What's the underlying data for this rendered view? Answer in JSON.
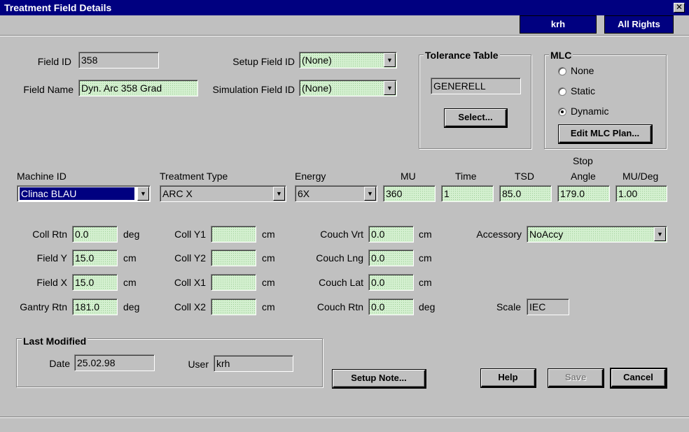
{
  "window": {
    "title": "Treatment Field Details",
    "close_glyph": "✕"
  },
  "header": {
    "user_badge": "krh",
    "rights_badge": "All Rights"
  },
  "field_id": {
    "label": "Field ID",
    "value": "358"
  },
  "field_name": {
    "label": "Field Name",
    "value": "Dyn. Arc 358 Grad"
  },
  "setup_field_id": {
    "label": "Setup Field ID",
    "value": "(None)"
  },
  "simulation_field_id": {
    "label": "Simulation Field ID",
    "value": "(None)"
  },
  "tolerance_table": {
    "title": "Tolerance Table",
    "value": "GENERELL",
    "select_button": "Select..."
  },
  "mlc": {
    "title": "MLC",
    "options": [
      "None",
      "Static",
      "Dynamic"
    ],
    "selected": "Dynamic",
    "edit_button": "Edit MLC Plan..."
  },
  "machine": {
    "machine_id_label": "Machine ID",
    "machine_id": "Clinac BLAU",
    "treatment_type_label": "Treatment Type",
    "treatment_type": "ARC X",
    "energy_label": "Energy",
    "energy": "6X",
    "mu_label": "MU",
    "mu": "360",
    "time_label": "Time",
    "time": "1",
    "tsd_label": "TSD",
    "tsd": "85.0",
    "stop_angle_label_1": "Stop",
    "stop_angle_label_2": "Angle",
    "stop_angle": "179.0",
    "mu_deg_label": "MU/Deg",
    "mu_deg": "1.00"
  },
  "geometry": {
    "coll_rtn": {
      "label": "Coll Rtn",
      "value": "0.0",
      "unit": "deg"
    },
    "field_y": {
      "label": "Field Y",
      "value": "15.0",
      "unit": "cm"
    },
    "field_x": {
      "label": "Field X",
      "value": "15.0",
      "unit": "cm"
    },
    "gantry_rtn": {
      "label": "Gantry Rtn",
      "value": "181.0",
      "unit": "deg"
    },
    "coll_y1": {
      "label": "Coll Y1",
      "value": "",
      "unit": "cm"
    },
    "coll_y2": {
      "label": "Coll Y2",
      "value": "",
      "unit": "cm"
    },
    "coll_x1": {
      "label": "Coll X1",
      "value": "",
      "unit": "cm"
    },
    "coll_x2": {
      "label": "Coll X2",
      "value": "",
      "unit": "cm"
    },
    "couch_vrt": {
      "label": "Couch Vrt",
      "value": "0.0",
      "unit": "cm"
    },
    "couch_lng": {
      "label": "Couch Lng",
      "value": "0.0",
      "unit": "cm"
    },
    "couch_lat": {
      "label": "Couch Lat",
      "value": "0.0",
      "unit": "cm"
    },
    "couch_rtn": {
      "label": "Couch Rtn",
      "value": "0.0",
      "unit": "deg"
    },
    "accessory": {
      "label": "Accessory",
      "value": "NoAccy"
    },
    "scale": {
      "label": "Scale",
      "value": "IEC"
    }
  },
  "last_modified": {
    "title": "Last Modified",
    "date_label": "Date",
    "date": "25.02.98",
    "user_label": "User",
    "user": "krh"
  },
  "buttons": {
    "setup_note": "Setup Note...",
    "help": "Help",
    "save": "Save",
    "cancel": "Cancel"
  },
  "colors": {
    "title_bar": "#000080",
    "editable_field": "#d4f0d0",
    "face": "#c0c0c0"
  }
}
